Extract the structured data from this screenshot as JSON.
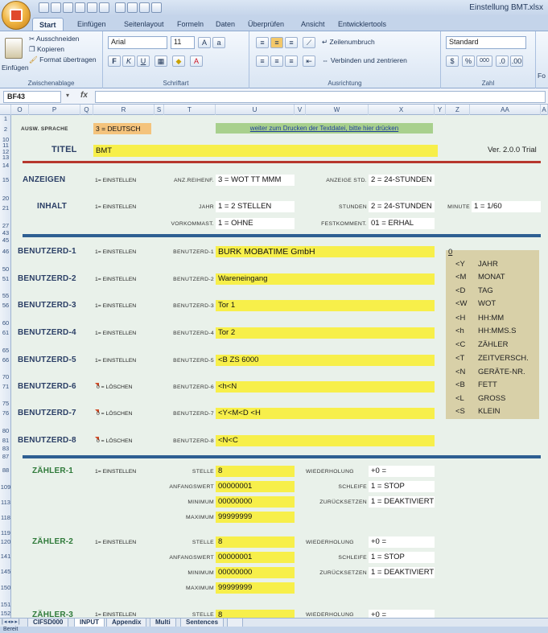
{
  "window": {
    "title": "Einstellung BMT.xlsx"
  },
  "ribbon": {
    "tabs": [
      "Start",
      "Einfügen",
      "Seitenlayout",
      "Formeln",
      "Daten",
      "Überprüfen",
      "Ansicht",
      "Entwicklertools"
    ],
    "active_tab": "Start",
    "clipboard": {
      "paste": "Einfügen",
      "cut": "Ausschneiden",
      "copy": "Kopieren",
      "format_painter": "Format übertragen",
      "label": "Zwischenablage"
    },
    "font": {
      "name": "Arial",
      "size": "11",
      "label": "Schriftart",
      "bold": "F",
      "italic": "K",
      "underline": "U"
    },
    "alignment": {
      "wrap": "Zeilenumbruch",
      "merge": "Verbinden und zentrieren",
      "label": "Ausrichtung"
    },
    "number": {
      "format": "Standard",
      "percent": "%",
      "thousands": "000",
      "label": "Zahl",
      "extra": "Fo"
    }
  },
  "formula_bar": {
    "name_box": "BF43",
    "fx": "fx"
  },
  "columns": [
    "O",
    "P",
    "Q",
    "R",
    "S",
    "T",
    "U",
    "V",
    "W",
    "X",
    "Y",
    "Z",
    "AA",
    "A"
  ],
  "rows": [
    "1",
    "2",
    "10",
    "11",
    "12",
    "13",
    "14",
    "15",
    "20",
    "21",
    "27",
    "43",
    "45",
    "46",
    "50",
    "51",
    "55",
    "56",
    "60",
    "61",
    "65",
    "66",
    "70",
    "71",
    "75",
    "76",
    "80",
    "81",
    "83",
    "87",
    "88",
    "109",
    "113",
    "118",
    "119",
    "120",
    "141",
    "145",
    "150",
    "151",
    "152"
  ],
  "sheet": {
    "lang_label": "AUSW. SPRACHE",
    "lang_value": "3 = DEUTSCH",
    "print_link": "weiter zum Drucken der Textdatei, bitte hier drücken",
    "titel_label": "TITEL",
    "titel_value": "BMT",
    "version": "Ver. 2.0.0 Trial",
    "anzeigen": {
      "label": "ANZEIGEN",
      "mode": "1= EINSTELLEN",
      "reihenf_label": "ANZ.REIHENF.",
      "reihenf_value": "3 = WOT TT MMM",
      "std_label": "ANZEIGE STD.",
      "std_value": "2 = 24-STUNDEN"
    },
    "inhalt": {
      "label": "INHALT",
      "mode": "1= EINSTELLEN",
      "jahr_label": "JAHR",
      "jahr_value": "1 = 2 STELLEN",
      "stunden_label": "STUNDEN",
      "stunden_value": "2 = 24-STUNDEN",
      "minute_label": "MINUTE",
      "minute_value": "1 = 1/60",
      "vorkomma_label": "VORKOMMAST.",
      "vorkomma_value": "1 = OHNE",
      "fest_label": "FESTKOMMENT.",
      "fest_value": "01 = ERHAL"
    },
    "benutzer": [
      {
        "label": "BENUTZERD-1",
        "mode": "1= EINSTELLEN",
        "field_label": "BENUTZERD-1",
        "value": "BURK MOBATIME GmbH"
      },
      {
        "label": "BENUTZERD-2",
        "mode": "1= EINSTELLEN",
        "field_label": "BENUTZERD-2",
        "value": "Wareneingang"
      },
      {
        "label": "BENUTZERD-3",
        "mode": "1= EINSTELLEN",
        "field_label": "BENUTZERD-3",
        "value": "Tor 1"
      },
      {
        "label": "BENUTZERD-4",
        "mode": "1= EINSTELLEN",
        "field_label": "BENUTZERD-4",
        "value": "Tor 2"
      },
      {
        "label": "BENUTZERD-5",
        "mode": "1= EINSTELLEN",
        "field_label": "BENUTZERD-5",
        "value": "<B ZS 6000"
      },
      {
        "label": "BENUTZERD-6",
        "mode": "0 = LÖSCHEN",
        "field_label": "BENUTZERD-6",
        "value": "<h<N"
      },
      {
        "label": "BENUTZERD-7",
        "mode": "0 = LÖSCHEN",
        "field_label": "BENUTZERD-7",
        "value": "<Y<M<D <H"
      },
      {
        "label": "BENUTZERD-8",
        "mode": "0 = LÖSCHEN",
        "field_label": "BENUTZERD-8",
        "value": "<N<C"
      }
    ],
    "codes_header": "0",
    "codes": [
      {
        "code": "<Y",
        "desc": "JAHR"
      },
      {
        "code": "<M",
        "desc": "MONAT"
      },
      {
        "code": "<D",
        "desc": "TAG"
      },
      {
        "code": "<W",
        "desc": "WOT"
      },
      {
        "code": "<H",
        "desc": "HH:MM"
      },
      {
        "code": "<h",
        "desc": "HH:MMS.S"
      },
      {
        "code": "<C",
        "desc": "ZÄHLER"
      },
      {
        "code": "<T",
        "desc": "ZEITVERSCH."
      },
      {
        "code": "<N",
        "desc": "GERÄTE-NR."
      },
      {
        "code": "<B",
        "desc": "FETT"
      },
      {
        "code": "<L",
        "desc": "GROSS"
      },
      {
        "code": "<S",
        "desc": "KLEIN"
      }
    ],
    "zaehler": [
      {
        "label": "ZÄHLER-1",
        "mode": "1= EINSTELLEN",
        "stelle_label": "STELLE",
        "stelle": "8",
        "wdh_label": "WIEDERHOLUNG",
        "wdh": "+0 =",
        "anf_label": "ANFANGSWERT",
        "anf": "00000001",
        "schleife_label": "SCHLEIFE",
        "schleife": "1 = STOP",
        "min_label": "MINIMUM",
        "min": "00000000",
        "zur_label": "ZURÜCKSETZEN",
        "zur": "1 = DEAKTIVIERT",
        "max_label": "MAXIMUM",
        "max": "99999999"
      },
      {
        "label": "ZÄHLER-2",
        "mode": "1= EINSTELLEN",
        "stelle_label": "STELLE",
        "stelle": "8",
        "wdh_label": "WIEDERHOLUNG",
        "wdh": "+0 =",
        "anf_label": "ANFANGSWERT",
        "anf": "00000001",
        "schleife_label": "SCHLEIFE",
        "schleife": "1 = STOP",
        "min_label": "MINIMUM",
        "min": "00000000",
        "zur_label": "ZURÜCKSETZEN",
        "zur": "1 = DEAKTIVIERT",
        "max_label": "MAXIMUM",
        "max": "99999999"
      },
      {
        "label": "ZÄHLER-3",
        "mode": "1= EINSTELLEN",
        "stelle_label": "STELLE",
        "stelle": "8",
        "wdh_label": "WIEDERHOLUNG",
        "wdh": "+0 ="
      }
    ]
  },
  "sheet_tabs": [
    "CIFSD000",
    "INPUT",
    "Appendix",
    "Multi",
    "Sentences"
  ],
  "active_sheet": "INPUT",
  "status": "Bereit"
}
